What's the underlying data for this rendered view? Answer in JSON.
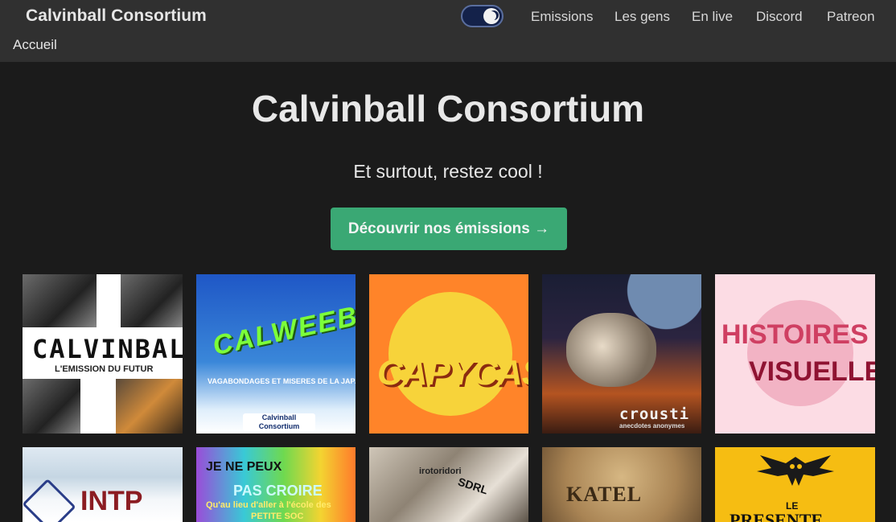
{
  "navbar": {
    "brand": "Calvinball Consortium",
    "home": "Accueil",
    "links": [
      "Emissions",
      "Les gens",
      "En live",
      "Discord",
      "Patreon"
    ]
  },
  "hero": {
    "title": "Calvinball Consortium",
    "subtitle": "Et surtout, restez cool !",
    "cta": "Découvrir nos émissions →"
  },
  "shows": [
    {
      "name": "CALVINBALL",
      "tagline": "L'EMISSION DU FUTUR"
    },
    {
      "name": "CALWEEB BALL",
      "tagline": "VAGABONDAGES ET MISERES DE LA JAPANIME",
      "badge": "Calvinball Consortium"
    },
    {
      "name": "CAPYCAST"
    },
    {
      "name": "crousti",
      "tagline": "anecdotes anonymes"
    },
    {
      "name_line1": "HISTOIRES",
      "name_line2": "VISUELLES"
    },
    {
      "name": "INTP"
    },
    {
      "line1": "JE NE PEUX",
      "line2": "PAS CROIRE",
      "line3": "Qu'au lieu d'aller à l'école des",
      "line4": "PETITE SOC"
    },
    {
      "name": "irotoridori",
      "extra": "SDRL"
    },
    {
      "name": "KATEL"
    },
    {
      "line1": "LE",
      "line2": "PRESENTE"
    }
  ],
  "colors": {
    "navbar": "#303030",
    "page": "#1b1b1b",
    "cta": "#3aa874",
    "toggle": "#14224a"
  }
}
